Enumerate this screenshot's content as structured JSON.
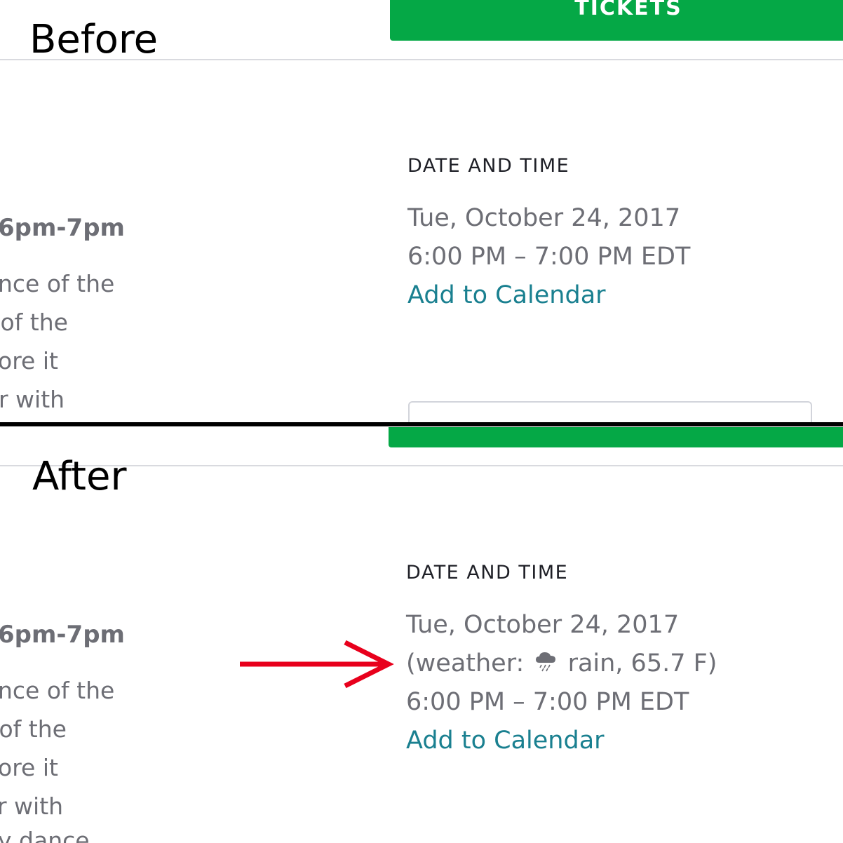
{
  "before": {
    "label": "Before",
    "tickets_button": "TICKETS",
    "left_heading": "6pm-7pm",
    "left_lines": [
      "nce of the",
      " of the",
      "ore it",
      "r with"
    ],
    "section_heading": "DATE AND TIME",
    "date": "Tue, October 24, 2017",
    "time": "6:00 PM – 7:00 PM EDT",
    "calendar_link": "Add to Calendar"
  },
  "after": {
    "label": "After",
    "left_heading": "6pm-7pm",
    "left_lines": [
      "nce of the",
      " of the",
      "ore it",
      "r with",
      "y dance"
    ],
    "section_heading": "DATE AND TIME",
    "date": "Tue, October 24, 2017",
    "weather_prefix": "(weather:",
    "weather_icon": "rain-cloud-icon",
    "weather_suffix": "rain, 65.7 F)",
    "time": "6:00 PM – 7:00 PM EDT",
    "calendar_link": "Add to Calendar"
  },
  "colors": {
    "button_green": "#05a846",
    "link_teal": "#1a8090",
    "body_gray": "#6d6e75",
    "heading_dark": "#1e1f26",
    "arrow_red": "#e8001c"
  }
}
